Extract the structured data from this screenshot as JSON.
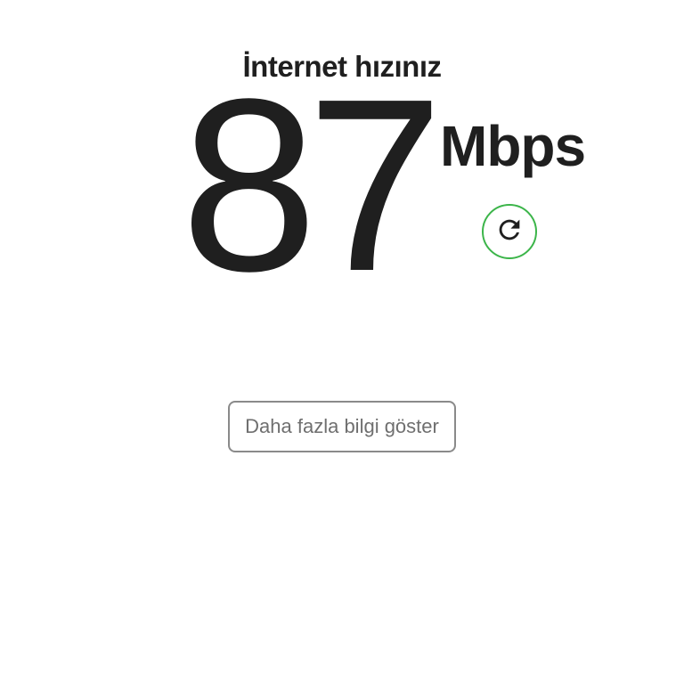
{
  "header": {
    "title": "İnternet hızınız"
  },
  "speed": {
    "value": "87",
    "unit": "Mbps"
  },
  "actions": {
    "refresh_icon": "refresh-icon",
    "more_info_label": "Daha fazla bilgi göster"
  },
  "colors": {
    "accent": "#3cb54a",
    "text": "#1f1f1f",
    "button_border": "#8a8a8a",
    "button_text": "#6f6f6f"
  }
}
